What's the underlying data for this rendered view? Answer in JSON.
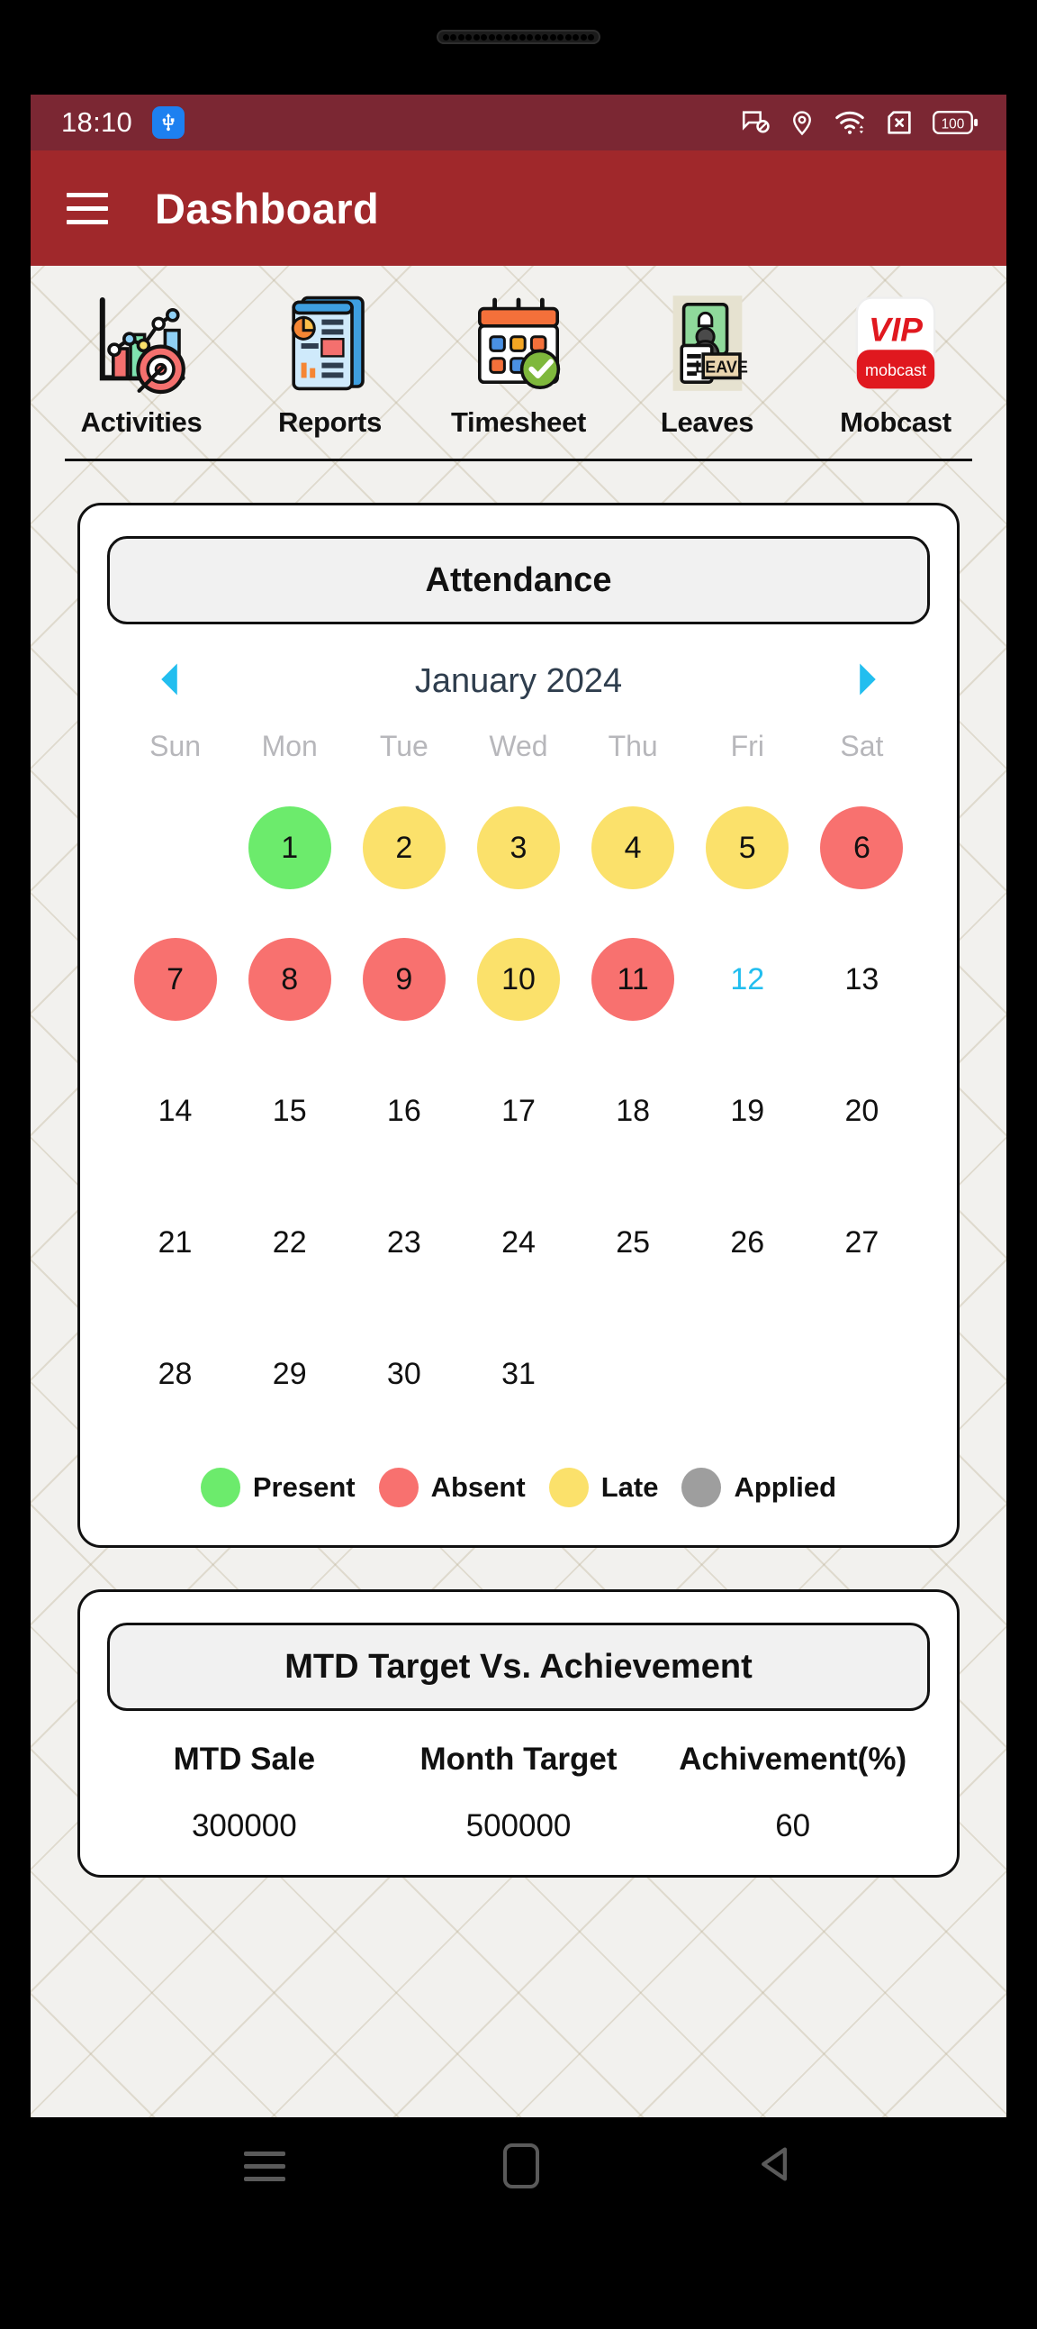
{
  "status_bar": {
    "time": "18:10",
    "usb_icon": "usb-icon",
    "icons": [
      "notifications-blocked-icon",
      "location-pin-icon",
      "wifi-icon",
      "no-sim-icon",
      "battery-icon"
    ],
    "battery_level": "100"
  },
  "app_bar": {
    "menu_icon": "hamburger-menu-icon",
    "title": "Dashboard"
  },
  "quick_actions": [
    {
      "label": "Activities",
      "icon": "activities-chart-target-icon"
    },
    {
      "label": "Reports",
      "icon": "reports-document-icon"
    },
    {
      "label": "Timesheet",
      "icon": "timesheet-calendar-check-icon"
    },
    {
      "label": "Leaves",
      "icon": "leaves-badge-icon"
    },
    {
      "label": "Mobcast",
      "icon": "vip-mobcast-logo-icon"
    }
  ],
  "attendance": {
    "title": "Attendance",
    "prev_icon": "chevron-left-icon",
    "next_icon": "chevron-right-icon",
    "month_label": "January 2024",
    "day_names": [
      "Sun",
      "Mon",
      "Tue",
      "Wed",
      "Thu",
      "Fri",
      "Sat"
    ],
    "lead_blanks": 1,
    "days": [
      {
        "n": "1",
        "state": "present"
      },
      {
        "n": "2",
        "state": "late"
      },
      {
        "n": "3",
        "state": "late"
      },
      {
        "n": "4",
        "state": "late"
      },
      {
        "n": "5",
        "state": "late"
      },
      {
        "n": "6",
        "state": "absent"
      },
      {
        "n": "7",
        "state": "absent"
      },
      {
        "n": "8",
        "state": "absent"
      },
      {
        "n": "9",
        "state": "absent"
      },
      {
        "n": "10",
        "state": "late"
      },
      {
        "n": "11",
        "state": "absent"
      },
      {
        "n": "12",
        "state": "today"
      },
      {
        "n": "13",
        "state": "none"
      },
      {
        "n": "14",
        "state": "none"
      },
      {
        "n": "15",
        "state": "none"
      },
      {
        "n": "16",
        "state": "none"
      },
      {
        "n": "17",
        "state": "none"
      },
      {
        "n": "18",
        "state": "none"
      },
      {
        "n": "19",
        "state": "none"
      },
      {
        "n": "20",
        "state": "none"
      },
      {
        "n": "21",
        "state": "none"
      },
      {
        "n": "22",
        "state": "none"
      },
      {
        "n": "23",
        "state": "none"
      },
      {
        "n": "24",
        "state": "none"
      },
      {
        "n": "25",
        "state": "none"
      },
      {
        "n": "26",
        "state": "none"
      },
      {
        "n": "27",
        "state": "none"
      },
      {
        "n": "28",
        "state": "none"
      },
      {
        "n": "29",
        "state": "none"
      },
      {
        "n": "30",
        "state": "none"
      },
      {
        "n": "31",
        "state": "none"
      }
    ],
    "legend": [
      {
        "label": "Present",
        "color": "#6CEB6C"
      },
      {
        "label": "Absent",
        "color": "#F8716F"
      },
      {
        "label": "Late",
        "color": "#FBE16B"
      },
      {
        "label": "Applied",
        "color": "#9E9E9E"
      }
    ],
    "state_colors": {
      "present": "#6CEB6C",
      "absent": "#F8716F",
      "late": "#FBE16B",
      "applied": "#9E9E9E",
      "today": "#22BEEF",
      "none": "transparent"
    }
  },
  "mtd": {
    "title": "MTD Target Vs. Achievement",
    "columns": [
      "MTD Sale",
      "Month Target",
      "Achivement(%)"
    ],
    "values": [
      "300000",
      "500000",
      "60"
    ]
  },
  "nav_bar": {
    "recents_icon": "recents-icon",
    "home_icon": "home-icon",
    "back_icon": "back-icon"
  },
  "theme": {
    "status_bar_bg": "#7B2733",
    "app_bar_bg": "#A0282B",
    "page_bg": "#F2F1EE",
    "accent_cyan": "#22BEEF"
  }
}
